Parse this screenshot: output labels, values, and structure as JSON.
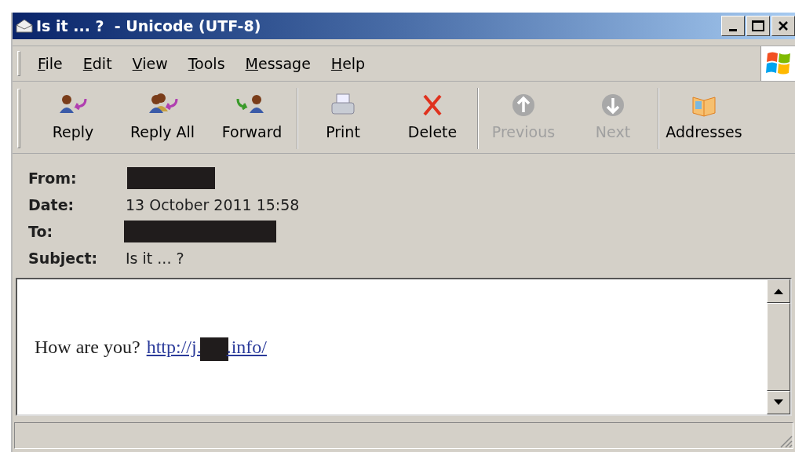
{
  "window": {
    "title": "Is it ... ?  - Unicode (UTF-8)"
  },
  "menu": [
    "File",
    "Edit",
    "View",
    "Tools",
    "Message",
    "Help"
  ],
  "toolbar": [
    {
      "kind": "button",
      "label": "Reply",
      "disabled": false
    },
    {
      "kind": "button",
      "label": "Reply All",
      "disabled": false
    },
    {
      "kind": "button",
      "label": "Forward",
      "disabled": false
    },
    {
      "kind": "separator"
    },
    {
      "kind": "button",
      "label": "Print",
      "disabled": false
    },
    {
      "kind": "button",
      "label": "Delete",
      "disabled": false
    },
    {
      "kind": "separator"
    },
    {
      "kind": "button",
      "label": "Previous",
      "disabled": true
    },
    {
      "kind": "button",
      "label": "Next",
      "disabled": true
    },
    {
      "kind": "separator"
    },
    {
      "kind": "button",
      "label": "Addresses",
      "disabled": false
    }
  ],
  "header": [
    {
      "kind": "redacted",
      "label": "From:"
    },
    {
      "kind": "text",
      "label": "Date:",
      "value": "13 October 2011 15:58"
    },
    {
      "kind": "redacted",
      "label": "To:"
    },
    {
      "kind": "text",
      "label": "Subject:",
      "value": "Is it ... ?"
    }
  ],
  "body": {
    "text": "How are you?",
    "link_start": "http://j.",
    "link_end": ".info/",
    "link_redacted": true
  }
}
